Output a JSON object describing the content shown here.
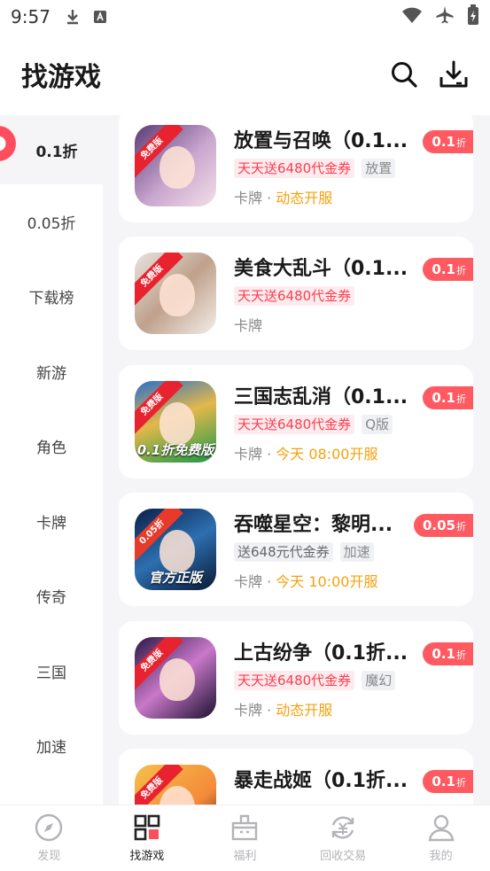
{
  "status_bar": {
    "time": "9:57"
  },
  "header": {
    "title": "找游戏"
  },
  "sidebar": {
    "active": "0.1折",
    "items": [
      "0.05折",
      "下载榜",
      "新游",
      "角色",
      "卡牌",
      "传奇",
      "三国",
      "加速"
    ]
  },
  "games": [
    {
      "name": "放置与召唤（0.1...",
      "badge": "免费版",
      "promo": "天天送6480代金券",
      "tag": "放置",
      "category": "卡牌",
      "separator": " · ",
      "status": "动态开服",
      "discount": "0.1",
      "discount_unit": "折"
    },
    {
      "name": "美食大乱斗（0.1...",
      "badge": "免费版",
      "promo": "天天送6480代金券",
      "tag": "",
      "category": "卡牌",
      "separator": "",
      "status": "",
      "discount": "0.1",
      "discount_unit": "折"
    },
    {
      "name": "三国志乱消（0.1...",
      "badge": "免费版",
      "promo": "天天送6480代金券",
      "tag": "Q版",
      "category": "卡牌",
      "separator": " · ",
      "status": "今天 08:00开服",
      "discount": "0.1",
      "discount_unit": "折",
      "caption": "0.1折免费版"
    },
    {
      "name": "吞噬星空：黎明...",
      "badge": "0.05折",
      "promo": "送648元代金券",
      "tag": "加速",
      "category": "卡牌",
      "separator": " · ",
      "status": "今天 10:00开服",
      "discount": "0.05",
      "discount_unit": "折",
      "caption": "官方正版"
    },
    {
      "name": "上古纷争（0.1折...",
      "badge": "免费版",
      "promo": "天天送6480代金券",
      "tag": "魔幻",
      "category": "卡牌",
      "separator": " · ",
      "status": "动态开服",
      "discount": "0.1",
      "discount_unit": "折"
    },
    {
      "name": "暴走战姬（0.1折...",
      "badge": "免费版",
      "promo": "",
      "tag": "",
      "category": "",
      "separator": "",
      "status": "",
      "discount": "0.1",
      "discount_unit": "折"
    }
  ],
  "bottom_nav": [
    {
      "label": "发现",
      "icon": "compass-icon"
    },
    {
      "label": "找游戏",
      "icon": "grid-icon",
      "active": true
    },
    {
      "label": "福利",
      "icon": "gift-icon"
    },
    {
      "label": "回收交易",
      "icon": "recycle-icon"
    },
    {
      "label": "我的",
      "icon": "user-icon"
    }
  ],
  "colors": {
    "accent": "#ff5a62",
    "highlight": "#f5a10c",
    "promo_bg": "#fdecee"
  }
}
